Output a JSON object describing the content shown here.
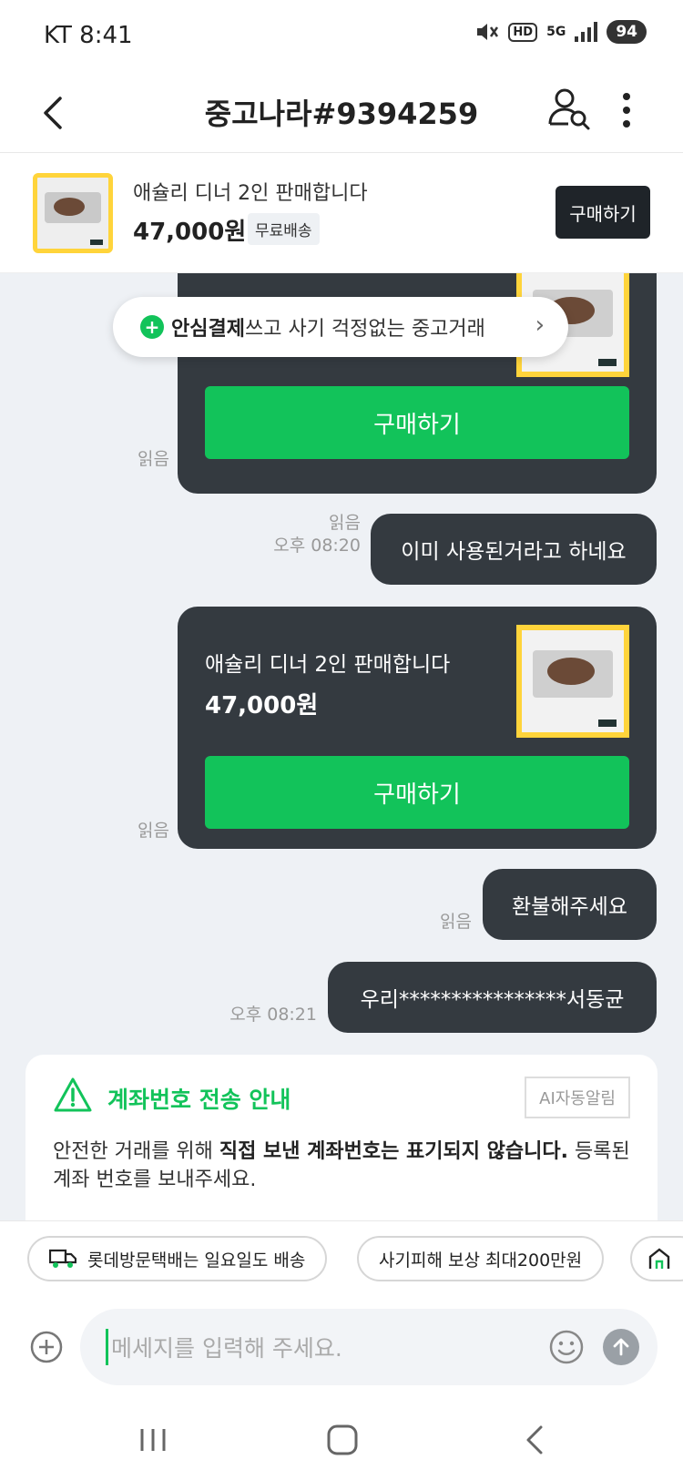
{
  "status_bar": {
    "carrier_time": "KT 8:41",
    "hd": "HD",
    "network": "5G",
    "battery": "94"
  },
  "header": {
    "title": "중고나라#9394259"
  },
  "product": {
    "name": "애슐리 디너 2인 판매합니다",
    "price": "47,000원",
    "shipping": "무료배송",
    "buy_label": "구매하기"
  },
  "chat": {
    "safe_pay": {
      "bold": "안심결제",
      "rest": "쓰고 사기 걱정없는 중고거래"
    },
    "card1": {
      "buy_label": "구매하기",
      "read": "읽음"
    },
    "msg1": {
      "text": "이미 사용된거라고 하네요",
      "read": "읽음",
      "time": "오후 08:20"
    },
    "card2": {
      "name": "애슐리 디너 2인 판매합니다",
      "price": "47,000원",
      "buy_label": "구매하기",
      "read": "읽음"
    },
    "msg2": {
      "text": "환불해주세요",
      "read": "읽음"
    },
    "msg3": {
      "text": "우리****************서동균",
      "time": "오후 08:21"
    },
    "notice": {
      "title": "계좌번호 전송 안내",
      "badge": "AI자동알림",
      "body_pre": "안전한 거래를 위해 ",
      "body_bold": "직접 보낸 계좌번호는 표기되지 않습니다.",
      "body_post": " 등록된 계좌 번호를 보내주세요."
    }
  },
  "chips": [
    "롯데방문택배는 일요일도 배송",
    "사기피해 보상 최대200만원"
  ],
  "input": {
    "placeholder": "메세지를 입력해 주세요."
  },
  "colors": {
    "accent_green": "#12c35a",
    "bubble_dark": "#343a40",
    "chat_bg": "#eef1f5",
    "thumb_border": "#ffd43b"
  }
}
